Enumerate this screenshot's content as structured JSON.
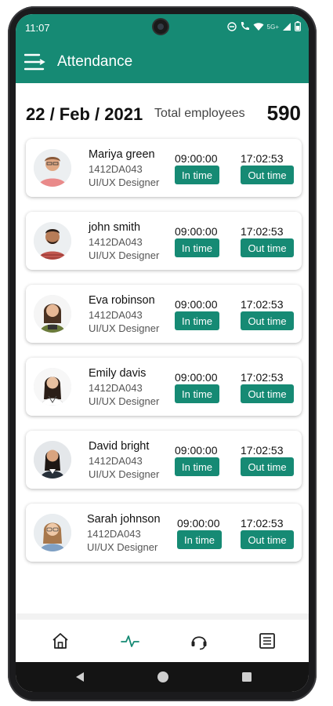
{
  "status_bar": {
    "time": "11:07",
    "network": "5G+",
    "icons": [
      "dnd-icon",
      "wifi-call-icon",
      "wifi-icon",
      "signal-icon",
      "battery-icon"
    ]
  },
  "app_bar": {
    "title": "Attendance",
    "color": "#168a74"
  },
  "summary": {
    "date": "22 / Feb / 2021",
    "total_label": "Total employees",
    "total_value": "590"
  },
  "employees": [
    {
      "name": "Mariya green",
      "id": "1412DA043",
      "role": "UI/UX Designer",
      "in_time": "09:00:00",
      "in_label": "In time",
      "out_time": "17:02:53",
      "out_label": "Out time"
    },
    {
      "name": "john smith",
      "id": "1412DA043",
      "role": "UI/UX Designer",
      "in_time": "09:00:00",
      "in_label": "In time",
      "out_time": "17:02:53",
      "out_label": "Out time"
    },
    {
      "name": "Eva robinson",
      "id": "1412DA043",
      "role": "UI/UX Designer",
      "in_time": "09:00:00",
      "in_label": "In time",
      "out_time": "17:02:53",
      "out_label": "Out time"
    },
    {
      "name": "Emily davis",
      "id": "1412DA043",
      "role": "UI/UX Designer",
      "in_time": "09:00:00",
      "in_label": "In time",
      "out_time": "17:02:53",
      "out_label": "Out time"
    },
    {
      "name": "David bright",
      "id": "1412DA043",
      "role": "UI/UX Designer",
      "in_time": "09:00:00",
      "in_label": "In time",
      "out_time": "17:02:53",
      "out_label": "Out time"
    },
    {
      "name": "Sarah johnson",
      "id": "1412DA043",
      "role": "UI/UX Designer",
      "in_time": "09:00:00",
      "in_label": "In time",
      "out_time": "17:02:53",
      "out_label": "Out time"
    }
  ],
  "bottom_nav": [
    "home-icon",
    "activity-icon",
    "headset-icon",
    "list-icon"
  ],
  "system_nav": [
    "back-icon",
    "home-circle-icon",
    "recents-icon"
  ]
}
